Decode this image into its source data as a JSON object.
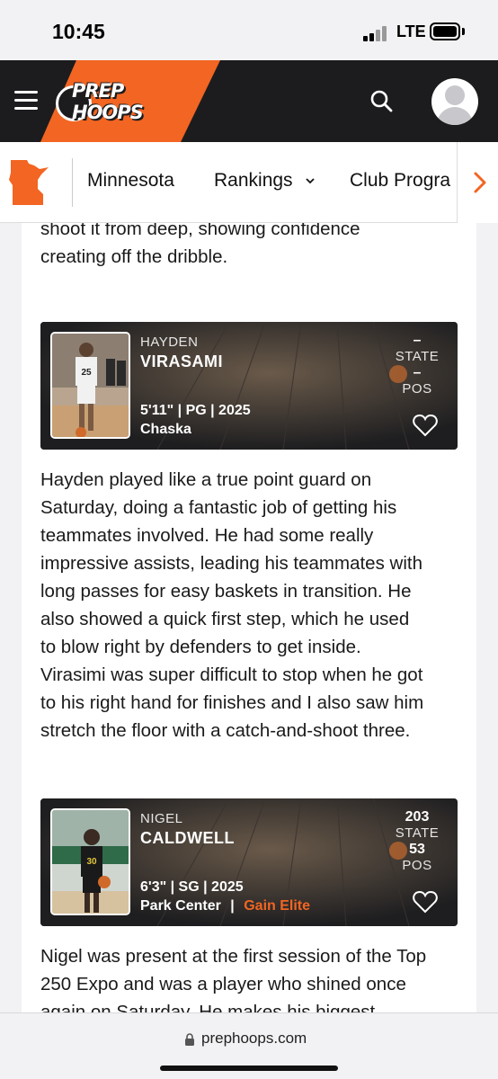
{
  "status": {
    "time": "10:45",
    "network": "LTE"
  },
  "header": {
    "logo_line1": "PREP",
    "logo_line2": "HOOPS"
  },
  "subnav": {
    "items": [
      "Minnesota",
      "Rankings",
      "Club Progra"
    ]
  },
  "article": {
    "intro_line1": "shoot it from deep, showing confidence",
    "intro_line2": "creating off the dribble.",
    "players": [
      {
        "first_name": "HAYDEN",
        "last_name": "VIRASAMI",
        "height_pos_class": "5'11\" | PG | 2025",
        "school": "Chaska",
        "club": "",
        "state_rank": "–",
        "state_label": "STATE",
        "pos_rank": "–",
        "pos_label": "POS",
        "jersey": "25"
      },
      {
        "first_name": "NIGEL",
        "last_name": "CALDWELL",
        "height_pos_class": "6'3\" | SG | 2025",
        "school": "Park Center",
        "separator": "|",
        "club": "Gain Elite",
        "state_rank": "203",
        "state_label": "STATE",
        "pos_rank": "53",
        "pos_label": "POS",
        "jersey": "30"
      }
    ],
    "hayden_lines": [
      "Hayden played like a true point guard on",
      "Saturday, doing a fantastic job of getting his",
      "teammates involved. He had some really",
      "impressive assists, leading his teammates with",
      "long passes for easy baskets in transition. He",
      "also showed a quick first step, which he used",
      "to blow right by defenders to get inside.",
      "Virasimi was super difficult to stop when he got",
      "to his right hand for finishes and I also saw him",
      "stretch the floor with a catch-and-shoot three."
    ],
    "nigel_lines": [
      "Nigel was present at the first session of the Top",
      "250 Expo and was a player who shined once",
      "again on Saturday. He makes his biggest"
    ]
  },
  "browser": {
    "url": "prephoops.com"
  },
  "colors": {
    "brand_orange": "#f26522",
    "header_dark": "#1c1c1e"
  }
}
